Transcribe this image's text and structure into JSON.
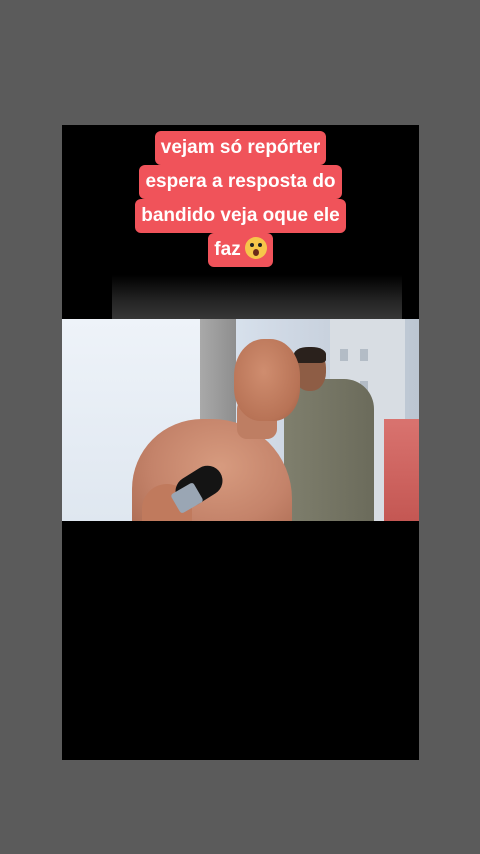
{
  "caption": {
    "lines": [
      "vejam só repórter",
      "espera a resposta do",
      "bandido veja oque ele",
      "faz"
    ],
    "emoji": "screaming-face-emoji"
  },
  "colors": {
    "background": "#5b5b5b",
    "caption_bg": "#f0535a",
    "caption_text": "#ffffff",
    "video_bg": "#000000"
  }
}
